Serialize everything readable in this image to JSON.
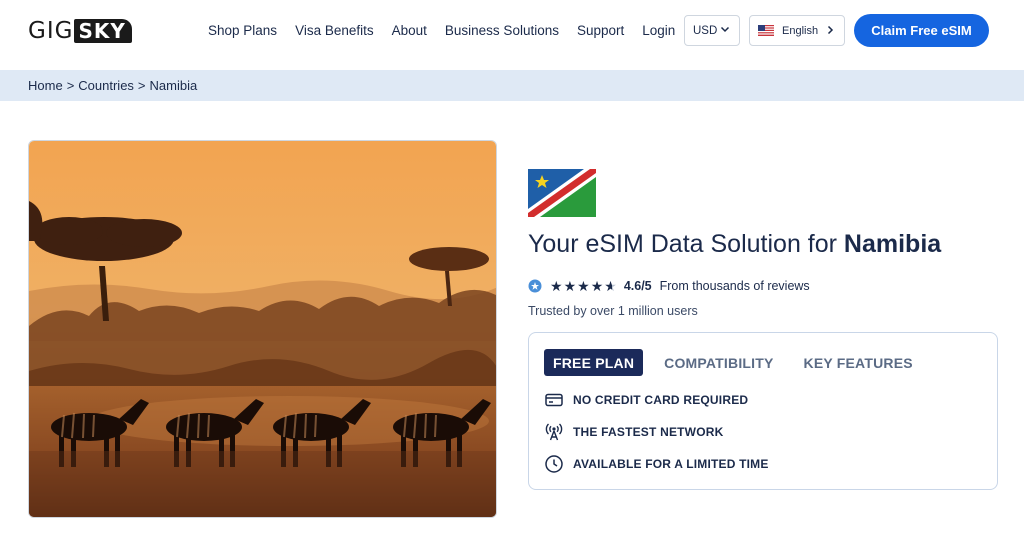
{
  "brand": {
    "logo_part1": "GIG",
    "logo_part2": "SKY"
  },
  "nav": {
    "items": [
      "Shop Plans",
      "Visa Benefits",
      "About",
      "Business Solutions",
      "Support",
      "Login"
    ]
  },
  "currency": {
    "selected": "USD"
  },
  "language": {
    "selected": "English"
  },
  "cta": {
    "label": "Claim Free eSIM"
  },
  "breadcrumb": {
    "items": [
      "Home",
      ">",
      "Countries",
      ">",
      "Namibia"
    ]
  },
  "hero": {
    "title_prefix": "Your eSIM Data Solution for ",
    "title_country": "Namibia"
  },
  "rating": {
    "score": "4.6/5",
    "reviews_text": "From thousands of reviews",
    "trusted_text": "Trusted by over 1 million users",
    "stars_value": 4.6
  },
  "tabs": [
    "FREE PLAN",
    "COMPATIBILITY",
    "KEY FEATURES"
  ],
  "features": [
    {
      "icon": "credit-card-icon",
      "label": "NO CREDIT CARD REQUIRED"
    },
    {
      "icon": "antenna-icon",
      "label": "THE FASTEST NETWORK"
    },
    {
      "icon": "clock-icon",
      "label": "AVAILABLE FOR A LIMITED TIME"
    }
  ],
  "colors": {
    "accent": "#1565e0",
    "navy": "#1b2a4a",
    "breadcrumb_bg": "#dfe9f5",
    "active_tab_bg": "#1b2a5a"
  }
}
